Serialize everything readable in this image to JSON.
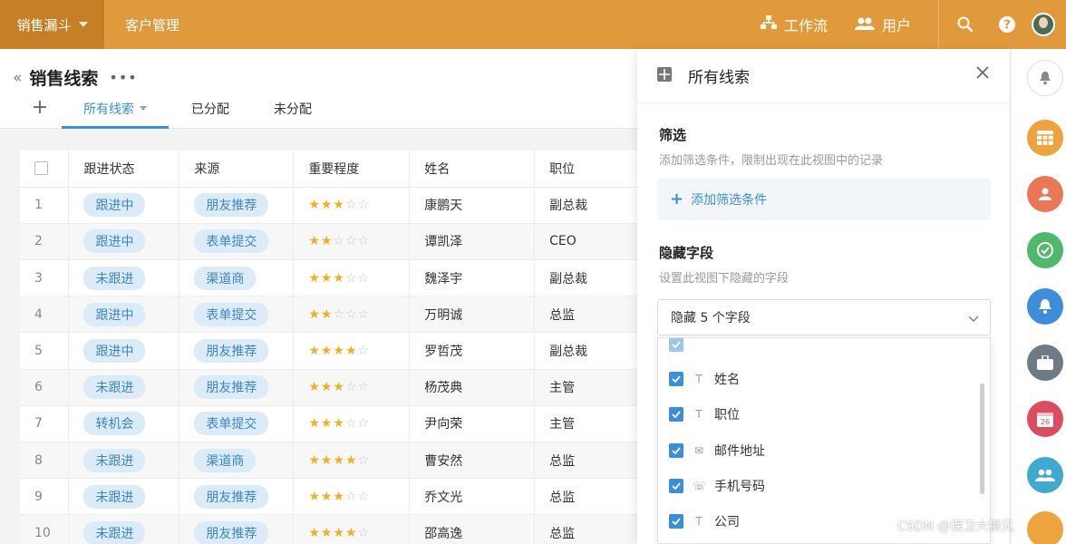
{
  "topbar": {
    "brand": "销售漏斗",
    "nav_item": "客户管理",
    "workflow": "工作流",
    "users": "用户"
  },
  "page": {
    "title": "销售线索",
    "tabs": [
      "所有线索",
      "已分配",
      "未分配"
    ]
  },
  "table": {
    "headers": [
      "跟进状态",
      "来源",
      "重要程度",
      "姓名",
      "职位"
    ],
    "rows": [
      {
        "n": "1",
        "status": "跟进中",
        "source": "朋友推荐",
        "stars": 3,
        "name": "康鹏天",
        "title": "副总裁"
      },
      {
        "n": "2",
        "status": "跟进中",
        "source": "表单提交",
        "stars": 2,
        "name": "谭凯泽",
        "title": "CEO"
      },
      {
        "n": "3",
        "status": "未跟进",
        "source": "渠道商",
        "stars": 3,
        "name": "魏泽宇",
        "title": "副总裁"
      },
      {
        "n": "4",
        "status": "跟进中",
        "source": "表单提交",
        "stars": 2,
        "name": "万明诚",
        "title": "总监"
      },
      {
        "n": "5",
        "status": "跟进中",
        "source": "朋友推荐",
        "stars": 4,
        "name": "罗哲茂",
        "title": "副总裁"
      },
      {
        "n": "6",
        "status": "未跟进",
        "source": "朋友推荐",
        "stars": 3,
        "name": "杨茂典",
        "title": "主管"
      },
      {
        "n": "7",
        "status": "转机会",
        "source": "表单提交",
        "stars": 3,
        "name": "尹向荣",
        "title": "主管"
      },
      {
        "n": "8",
        "status": "未跟进",
        "source": "渠道商",
        "stars": 4,
        "name": "曹安然",
        "title": "总监"
      },
      {
        "n": "9",
        "status": "未跟进",
        "source": "朋友推荐",
        "stars": 3,
        "name": "乔文光",
        "title": "总监"
      },
      {
        "n": "10",
        "status": "未跟进",
        "source": "朋友推荐",
        "stars": 4,
        "name": "邵高逸",
        "title": "总监"
      }
    ]
  },
  "panel": {
    "title": "所有线索",
    "filter_title": "筛选",
    "filter_desc": "添加筛选条件，限制出现在此视图中的记录",
    "add_filter": "添加筛选条件",
    "hidden_title": "隐藏字段",
    "hidden_desc": "设置此视图下隐藏的字段",
    "hidden_select": "隐藏 5 个字段",
    "fields": [
      {
        "label": "姓名",
        "type": "T"
      },
      {
        "label": "职位",
        "type": "T"
      },
      {
        "label": "邮件地址",
        "type": "✉"
      },
      {
        "label": "手机号码",
        "type": "☏"
      },
      {
        "label": "公司",
        "type": "T"
      }
    ]
  },
  "watermark": "CSDN @保卫大狮兄",
  "colors": {
    "topbar": "#e09a3b",
    "brand": "#c77f25",
    "accent": "#3b8fd8",
    "star": "#f2b01e"
  }
}
